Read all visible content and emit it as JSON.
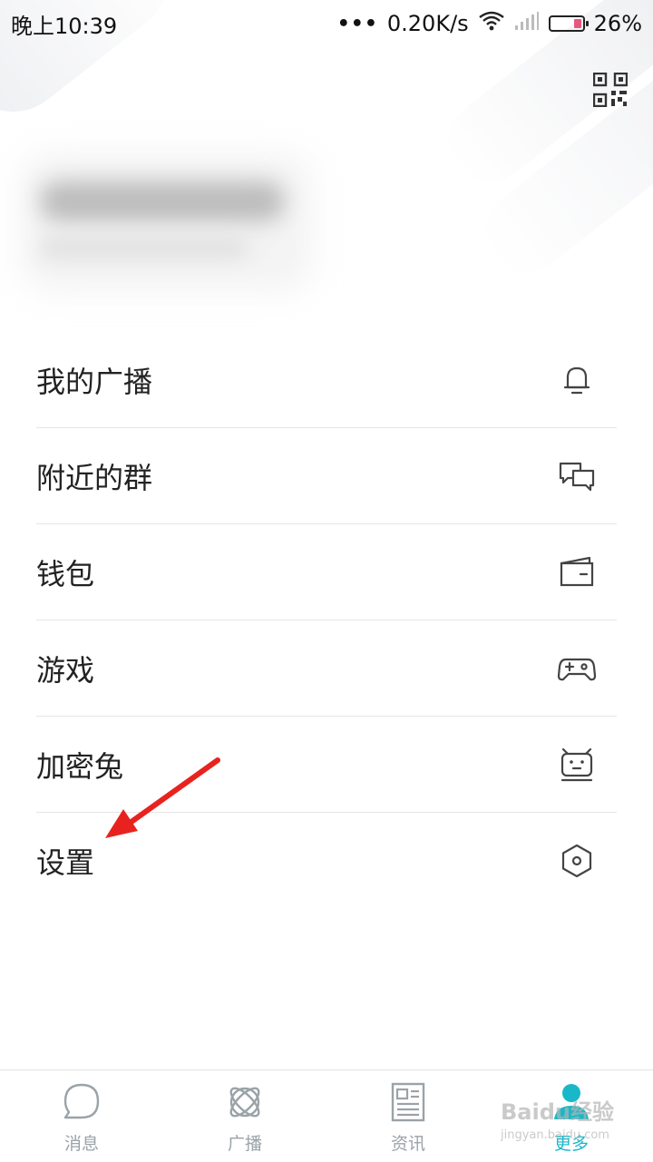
{
  "status_bar": {
    "time": "晚上10:39",
    "dots": "•••",
    "speed": "0.20K/s",
    "battery_percent": "26%",
    "battery_level": 0.26,
    "icons": [
      "wifi-icon",
      "signal-icon",
      "battery-icon"
    ]
  },
  "header": {
    "qr_icon": "qr-code-icon"
  },
  "menu": {
    "items": [
      {
        "label": "我的广播",
        "icon": "bell-icon"
      },
      {
        "label": "附近的群",
        "icon": "chat-bubbles-icon"
      },
      {
        "label": "钱包",
        "icon": "wallet-icon"
      },
      {
        "label": "游戏",
        "icon": "gamepad-icon"
      },
      {
        "label": "加密兔",
        "icon": "robot-icon"
      },
      {
        "label": "设置",
        "icon": "settings-hexagon-icon"
      }
    ]
  },
  "tabbar": {
    "tabs": [
      {
        "label": "消息",
        "icon": "message-icon",
        "active": false
      },
      {
        "label": "广播",
        "icon": "broadcast-orbit-icon",
        "active": false
      },
      {
        "label": "资讯",
        "icon": "news-icon",
        "active": false
      },
      {
        "label": "更多",
        "icon": "user-more-icon",
        "active": true
      }
    ]
  },
  "colors": {
    "accent": "#19b8c9",
    "tab_inactive": "#9aa3a8",
    "text": "#222222",
    "divider": "#e6e6e6",
    "battery_low": "#e8567f",
    "annotation_arrow": "#e8231f"
  },
  "watermark": {
    "text": "Baidu经验",
    "sub": "jingyan.baidu.com"
  }
}
